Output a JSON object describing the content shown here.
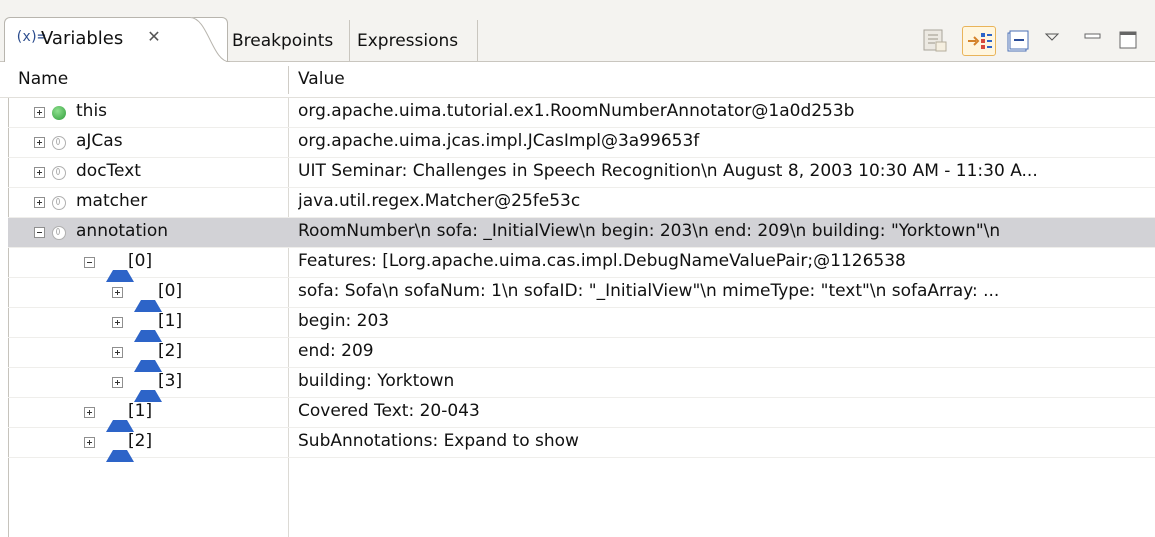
{
  "tabs": {
    "variables_icon": "(x)=",
    "variables_label": "Variables",
    "variables_close": "✕",
    "breakpoints_label": "Breakpoints",
    "expressions_label": "Expressions"
  },
  "table": {
    "col_name": "Name",
    "col_value": "Value"
  },
  "rows": [
    {
      "name": "this",
      "value": "org.apache.uima.tutorial.ex1.RoomNumberAnnotator@1a0d253b",
      "toggle": "plus",
      "icon": "green-dot",
      "level": 0
    },
    {
      "name": "aJCas",
      "value": "org.apache.uima.jcas.impl.JCasImpl@3a99653f",
      "toggle": "plus",
      "icon": "gray-dot",
      "level": 0
    },
    {
      "name": "docText",
      "value": "UIT Seminar: Challenges in Speech Recognition\\n  August 8, 2003   10:30 AM - 11:30 A...",
      "toggle": "plus",
      "icon": "gray-dot",
      "level": 0
    },
    {
      "name": "matcher",
      "value": "java.util.regex.Matcher@25fe53c",
      "toggle": "plus",
      "icon": "gray-dot",
      "level": 0
    },
    {
      "name": "annotation",
      "value": "RoomNumber\\n   sofa: _InitialView\\n   begin: 203\\n   end: 209\\n   building: \"Yorktown\"\\n",
      "toggle": "minus",
      "icon": "gray-dot",
      "level": 0,
      "selected": true
    },
    {
      "name": "[0]",
      "value": "Features: [Lorg.apache.uima.cas.impl.DebugNameValuePair;@1126538",
      "toggle": "minus",
      "icon": "blue-triangle",
      "level": 1
    },
    {
      "name": "[0]",
      "value": "sofa: Sofa\\n   sofaNum: 1\\n   sofaID: \"_InitialView\"\\n   mimeType: \"text\"\\n   sofaArray: ...",
      "toggle": "plus",
      "icon": "blue-triangle",
      "level": 2
    },
    {
      "name": "[1]",
      "value": "begin: 203",
      "toggle": "plus",
      "icon": "blue-triangle",
      "level": 2
    },
    {
      "name": "[2]",
      "value": "end: 209",
      "toggle": "plus",
      "icon": "blue-triangle",
      "level": 2
    },
    {
      "name": "[3]",
      "value": "building: Yorktown",
      "toggle": "plus",
      "icon": "blue-triangle",
      "level": 2
    },
    {
      "name": "[1]",
      "value": "Covered Text: 20-043",
      "toggle": "plus",
      "icon": "blue-triangle",
      "level": 1
    },
    {
      "name": "[2]",
      "value": "SubAnnotations: Expand to show",
      "toggle": "plus",
      "icon": "blue-triangle",
      "level": 1
    }
  ]
}
